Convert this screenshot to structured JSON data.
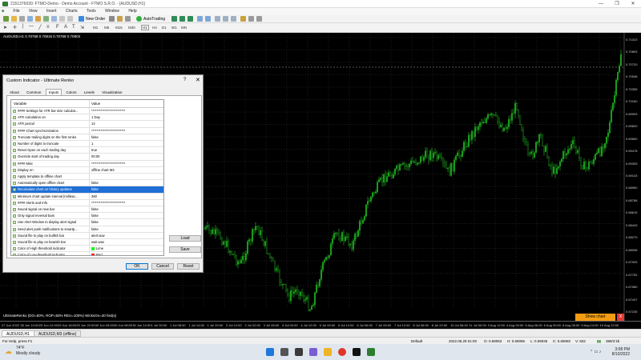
{
  "window": {
    "title": "2151376030: FTMO-Demo - Demo Account - FTMO S.R.O. - [AUDUSD,H1]",
    "controls": [
      "—",
      "❐",
      "✕"
    ]
  },
  "menu": [
    "File",
    "View",
    "Insert",
    "Charts",
    "Tools",
    "Window",
    "Help"
  ],
  "toolbar": {
    "new_order": "New Order",
    "autotrading": "AutoTrading",
    "timeframes": [
      "M1",
      "M5",
      "M15",
      "M30",
      "H1",
      "H4",
      "D1",
      "W1",
      "MN"
    ]
  },
  "chart": {
    "label": "AUDUSD,H1  0.70768 0.70816 0.70768 0.70804",
    "indicator_label": "UltimateRenko (DO=50%, ROP=50% REU=100%) WicksOn=40 hist(s)",
    "price_axis": [
      "0.71023",
      "0.70893",
      "0.70720",
      "0.70548",
      "0.70355",
      "0.70160",
      "0.69993",
      "0.69820",
      "0.69650",
      "0.69478",
      "0.69305",
      "0.69133",
      "0.68960",
      "0.68788",
      "0.68615",
      "0.68443",
      "0.68270",
      "0.68098",
      "0.67925",
      "0.67752",
      "0.67580",
      "0.67407",
      "0.67235"
    ],
    "time_axis": [
      "27 Jun 2022",
      "28 Jun 10:00",
      "29 Jun 12:00",
      "29 Jun 18:00",
      "29 Jun 22:00",
      "30 Jun 03:00",
      "30 Jun 08:00",
      "30 Jun 12:00",
      "1 Jul 00:00",
      "1 Jul 08:00",
      "1 Jul 14:00",
      "1 Jul 20:00",
      "2 Jul 12:00",
      "2 Jul 22:00",
      "3 Jul 06:00",
      "4 Jul 00:00",
      "4 Jul 12:00",
      "5 Jul 00:00",
      "5 Jul 12:00",
      "6 Jul 06:00",
      "7 Jul 00:00",
      "7 Jul 12:00",
      "8 Jul 06:00",
      "8 Jul 22:00",
      "10 Jul 06:00",
      "11 Jul 00:00",
      "3 Aug 12:00",
      "4 Aug 00:00",
      "5 Aug 06:00",
      "6 Aug 00:00",
      "8 Aug 06:00",
      "9 Aug 14:00",
      "10 Aug 22:00"
    ],
    "show_chart": "Show chart",
    "close": "X",
    "candle_color": "#22c322",
    "background": "#000000"
  },
  "chart_tabs": [
    "AUDUSD,H1",
    "AUDUSD,M3 (offline)"
  ],
  "status": {
    "help": "For Help, press F1",
    "profile": "Default",
    "datetime": "2022.06.29 01:00",
    "open": "O: 0.69053",
    "high": "H: 0.69096",
    "low": "L: 0.69036",
    "close": "C: 0.69060",
    "volume": "V: 832",
    "traffic": "388/3 kb"
  },
  "taskbar": {
    "temp": "74°F",
    "weather": "Mostly cloudy",
    "time": "3:08 PM",
    "date": "8/10/2022"
  },
  "dialog": {
    "title": "Custom Indicator - Ultimate Renko",
    "help": "?",
    "close": "✕",
    "tabs": [
      "About",
      "Common",
      "Inputs",
      "Colors",
      "Levels",
      "Visualization"
    ],
    "active_tab": "Inputs",
    "col_variable": "Variable",
    "col_value": "Value",
    "rows": [
      {
        "name": "#### Settings for ATR bar size calculat...",
        "value": "**************************"
      },
      {
        "name": "ATR calculation on",
        "value": "1 Day"
      },
      {
        "name": "ATR period",
        "value": "14"
      },
      {
        "name": "#### Chart synchronization",
        "value": "**************************"
      },
      {
        "name": "Truncate trailing digits on the first renko",
        "value": "false"
      },
      {
        "name": "Number of digits to truncate",
        "value": "1"
      },
      {
        "name": "Reset Open on each trading day",
        "value": "true"
      },
      {
        "name": "Override start of trading day",
        "value": "00:00"
      },
      {
        "name": "#### Misc",
        "value": "**************************"
      },
      {
        "name": "Display on",
        "value": "offline chart M3"
      },
      {
        "name": "Apply template to offline chart",
        "value": ""
      },
      {
        "name": "Automatically open offline chart",
        "value": "false"
      },
      {
        "name": "Recalculate chart on history updates",
        "value": "false"
      },
      {
        "name": "Minimum chart update interval [millisec...",
        "value": "360"
      },
      {
        "name": "#### Alerts and Info",
        "value": "**************************"
      },
      {
        "name": "Sound signal on new bar",
        "value": "false"
      },
      {
        "name": "Only signal reversal bars",
        "value": "false"
      },
      {
        "name": "Use Alert Window to display alert signal",
        "value": "false"
      },
      {
        "name": "Send alert push notifications to smartp...",
        "value": "false"
      },
      {
        "name": "Sound file to play on bullish bar",
        "value": "alert.wav"
      },
      {
        "name": "Sound file to play on bearish bar",
        "value": "wait.wav"
      },
      {
        "name": "Color of High threshold indicator",
        "value": "Lime",
        "swatch": "#00ff00"
      },
      {
        "name": "Color of Low threshold indicator",
        "value": "Red",
        "swatch": "#ff0000"
      }
    ],
    "selected_row": "Recalculate chart on history updates",
    "load": "Load",
    "save": "Save",
    "ok": "OK",
    "cancel": "Cancel",
    "reset": "Reset"
  }
}
